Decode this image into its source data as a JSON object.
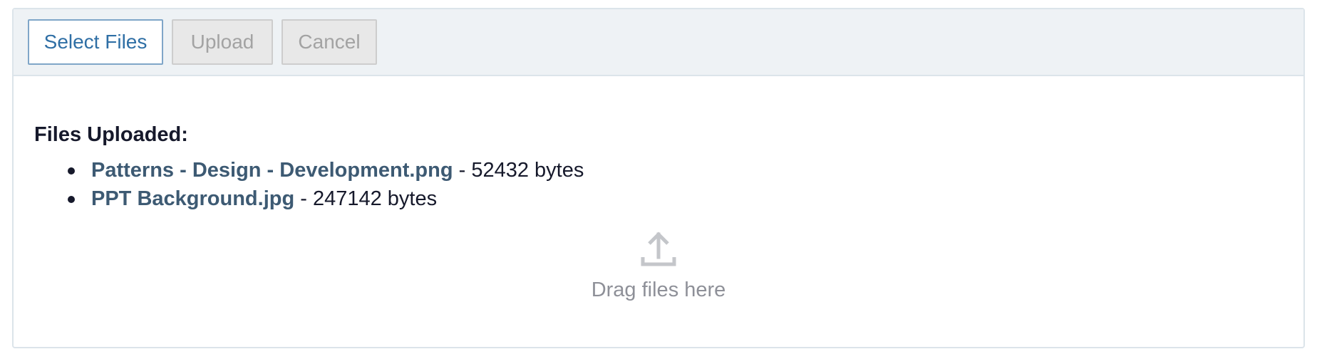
{
  "toolbar": {
    "select_label": "Select Files",
    "upload_label": "Upload",
    "cancel_label": "Cancel"
  },
  "files": {
    "heading": "Files Uploaded:",
    "items": [
      {
        "name": "Patterns - Design - Development.png",
        "size_text": " - 52432 bytes"
      },
      {
        "name": "PPT Background.jpg",
        "size_text": " - 247142 bytes"
      }
    ]
  },
  "dropzone": {
    "icon": "upload-icon",
    "text": "Drag files here"
  },
  "colors": {
    "accent": "#2f6fa5",
    "file_link": "#3d5a73",
    "toolbar_bg": "#eef2f5",
    "muted_text": "#8e9098"
  }
}
